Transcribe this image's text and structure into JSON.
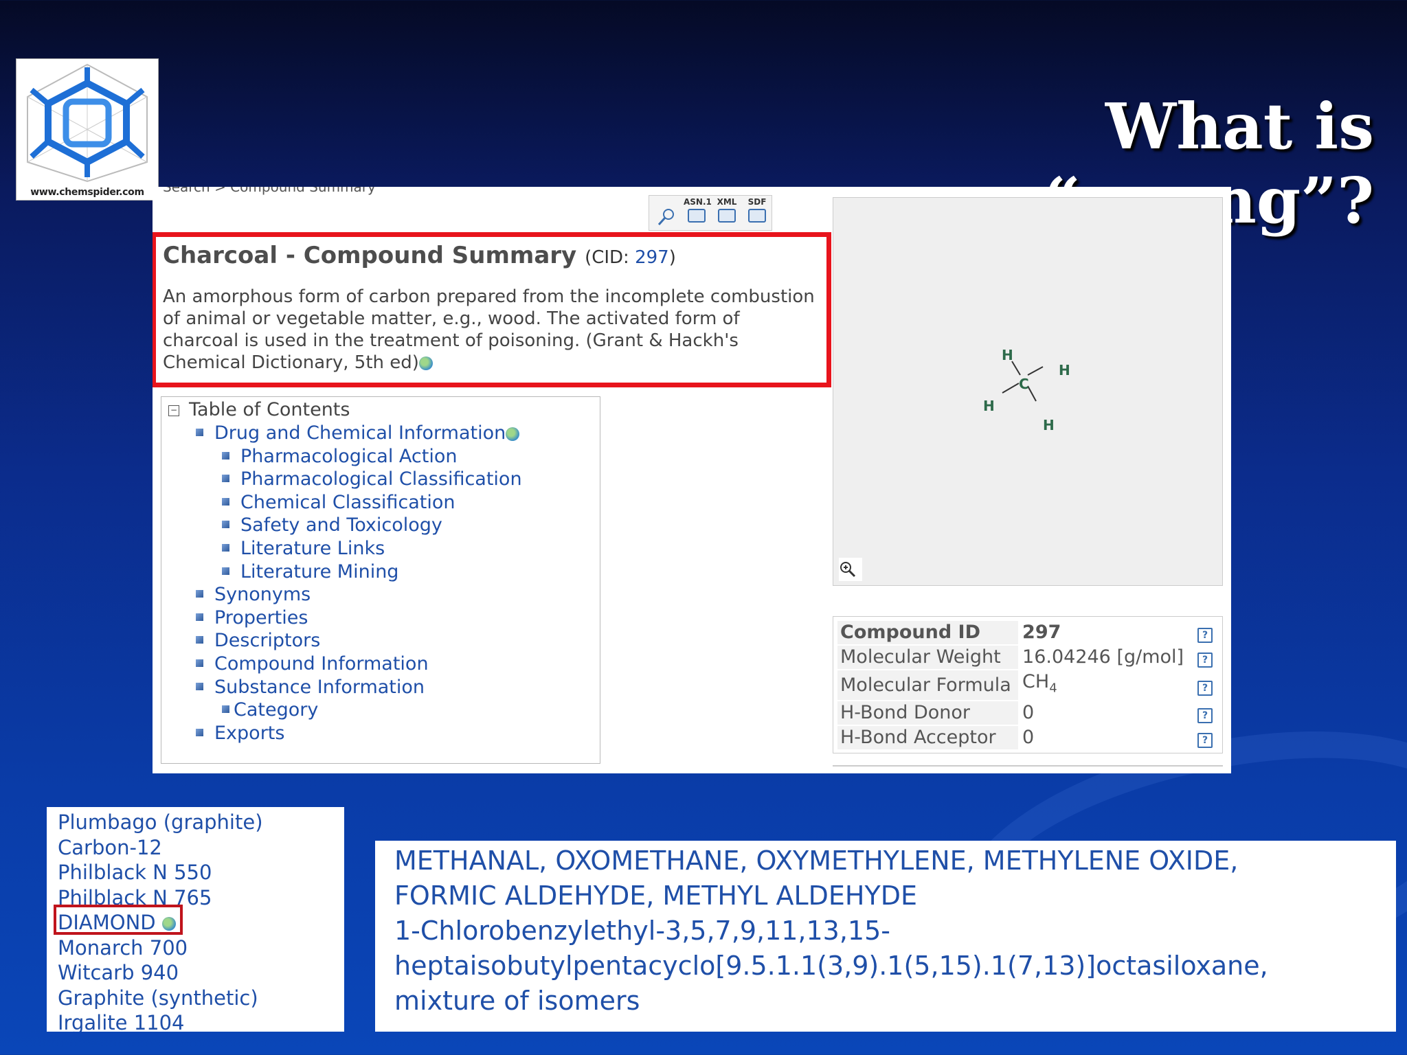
{
  "slide": {
    "title": "What is “wrong”?"
  },
  "logo": {
    "text": "www.chemspider.com"
  },
  "page": {
    "breadcrumb": "Search > Compound Summary",
    "toolbar": {
      "asn_label": "ASN.1",
      "xml_label": "XML",
      "sdf_label": "SDF"
    },
    "summary": {
      "title": "Charcoal - Compound Summary",
      "cid_prefix": "(CID: ",
      "cid": "297",
      "cid_suffix": ")",
      "description": "An amorphous form of carbon prepared from the incomplete combustion of animal or vegetable matter, e.g., wood. The activated form of charcoal is used in the treatment of poisoning. (Grant & Hackh's Chemical Dictionary, 5th ed)"
    },
    "toc": {
      "heading": "Table of Contents",
      "items": [
        {
          "label": "Drug and Chemical Information"
        },
        {
          "label": "Pharmacological Action"
        },
        {
          "label": "Pharmacological Classification"
        },
        {
          "label": "Chemical Classification"
        },
        {
          "label": "Safety and Toxicology"
        },
        {
          "label": "Literature Links"
        },
        {
          "label": "Literature Mining"
        },
        {
          "label": "Synonyms"
        },
        {
          "label": "Properties"
        },
        {
          "label": "Descriptors"
        },
        {
          "label": "Compound Information"
        },
        {
          "label": "Substance Information"
        },
        {
          "label": "Category"
        },
        {
          "label": "Exports"
        }
      ]
    },
    "structure": {
      "atoms": [
        "H",
        "H",
        "C",
        "H",
        "H"
      ]
    },
    "properties": {
      "rows": [
        {
          "key": "Compound ID",
          "value": "297"
        },
        {
          "key": "Molecular Weight",
          "value": "16.04246 [g/mol]"
        },
        {
          "key": "Molecular Formula",
          "value": "CH",
          "sub": "4"
        },
        {
          "key": "H-Bond Donor",
          "value": "0"
        },
        {
          "key": "H-Bond Acceptor",
          "value": "0"
        }
      ]
    }
  },
  "synonyms": [
    "Plumbago (graphite)",
    "Carbon-12",
    "Philblack N 550",
    "Philblack N 765",
    "DIAMOND",
    "Monarch 700",
    "Witcarb 940",
    "Graphite (synthetic)",
    "Irgalite 1104"
  ],
  "names": [
    "METHANAL, OXOMETHANE, OXYMETHYLENE, METHYLENE OXIDE,",
    "FORMIC ALDEHYDE, METHYL ALDEHYDE",
    "1-Chlorobenzylethyl-3,5,7,9,11,13,15-",
    "heptaisobutylpentacyclo[9.5.1.1(3,9).1(5,15).1(7,13)]octasiloxane,",
    "mixture of isomers"
  ]
}
